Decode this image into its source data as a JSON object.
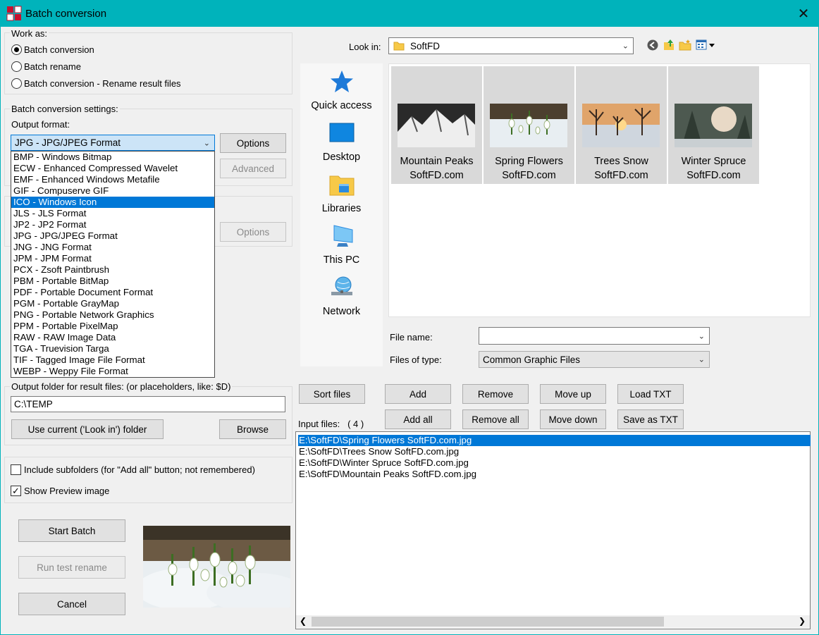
{
  "window": {
    "title": "Batch conversion",
    "close_glyph": "✕"
  },
  "work_as": {
    "label": "Work as:",
    "options": [
      {
        "label": "Batch conversion",
        "selected": true
      },
      {
        "label": "Batch rename",
        "selected": false
      },
      {
        "label": "Batch conversion - Rename result files",
        "selected": false
      }
    ]
  },
  "settings": {
    "label": "Batch conversion settings:",
    "output_format_label": "Output format:",
    "output_format_value": "JPG - JPG/JPEG Format",
    "options_btn": "Options",
    "advanced_btn": "Advanced",
    "options2_btn": "Options"
  },
  "formats": [
    "BMP - Windows Bitmap",
    "ECW - Enhanced Compressed Wavelet",
    "EMF - Enhanced Windows Metafile",
    "GIF - Compuserve GIF",
    "ICO - Windows Icon",
    "JLS - JLS Format",
    "JP2 - JP2 Format",
    "JPG - JPG/JPEG Format",
    "JNG - JNG Format",
    "JPM - JPM Format",
    "PCX - Zsoft Paintbrush",
    "PBM - Portable BitMap",
    "PDF - Portable Document Format",
    "PGM - Portable GrayMap",
    "PNG - Portable Network Graphics",
    "PPM - Portable PixelMap",
    "RAW - RAW Image Data",
    "TGA - Truevision Targa",
    "TIF - Tagged Image File Format",
    "WEBP - Weppy File Format"
  ],
  "formats_selected": "ICO - Windows Icon",
  "output_folder": {
    "label": "Output folder for result files: (or placeholders, like: $D)",
    "value": "C:\\TEMP",
    "use_current_btn": "Use current ('Look in') folder",
    "browse_btn": "Browse"
  },
  "include_subfolders": {
    "label": "Include subfolders (for \"Add all\" button; not remembered)",
    "checked": false
  },
  "show_preview": {
    "label": "Show Preview image",
    "checked": true
  },
  "actions": {
    "start": "Start Batch",
    "test": "Run test rename",
    "cancel": "Cancel"
  },
  "browser": {
    "look_in_label": "Look in:",
    "look_in_value": "SoftFD",
    "places": [
      "Quick access",
      "Desktop",
      "Libraries",
      "This PC",
      "Network"
    ],
    "files": [
      {
        "name": "Mountain Peaks",
        "sub": "SoftFD.com"
      },
      {
        "name": "Spring Flowers",
        "sub": "SoftFD.com"
      },
      {
        "name": "Trees Snow",
        "sub": "SoftFD.com"
      },
      {
        "name": "Winter Spruce",
        "sub": "SoftFD.com"
      }
    ],
    "file_name_label": "File name:",
    "file_name_value": "",
    "file_type_label": "Files of type:",
    "file_type_value": "Common Graphic Files"
  },
  "list_buttons": {
    "sort": "Sort files",
    "add": "Add",
    "remove": "Remove",
    "move_up": "Move up",
    "load_txt": "Load TXT",
    "add_all": "Add all",
    "remove_all": "Remove all",
    "move_down": "Move down",
    "save_txt": "Save as TXT"
  },
  "input_files": {
    "label": "Input files:",
    "count": "( 4 )",
    "items": [
      "E:\\SoftFD\\Spring Flowers SoftFD.com.jpg",
      "E:\\SoftFD\\Trees Snow SoftFD.com.jpg",
      "E:\\SoftFD\\Winter Spruce SoftFD.com.jpg",
      "E:\\SoftFD\\Mountain Peaks SoftFD.com.jpg"
    ]
  },
  "colors": {
    "titlebar": "#00b3bb",
    "selection": "#0078d7"
  }
}
